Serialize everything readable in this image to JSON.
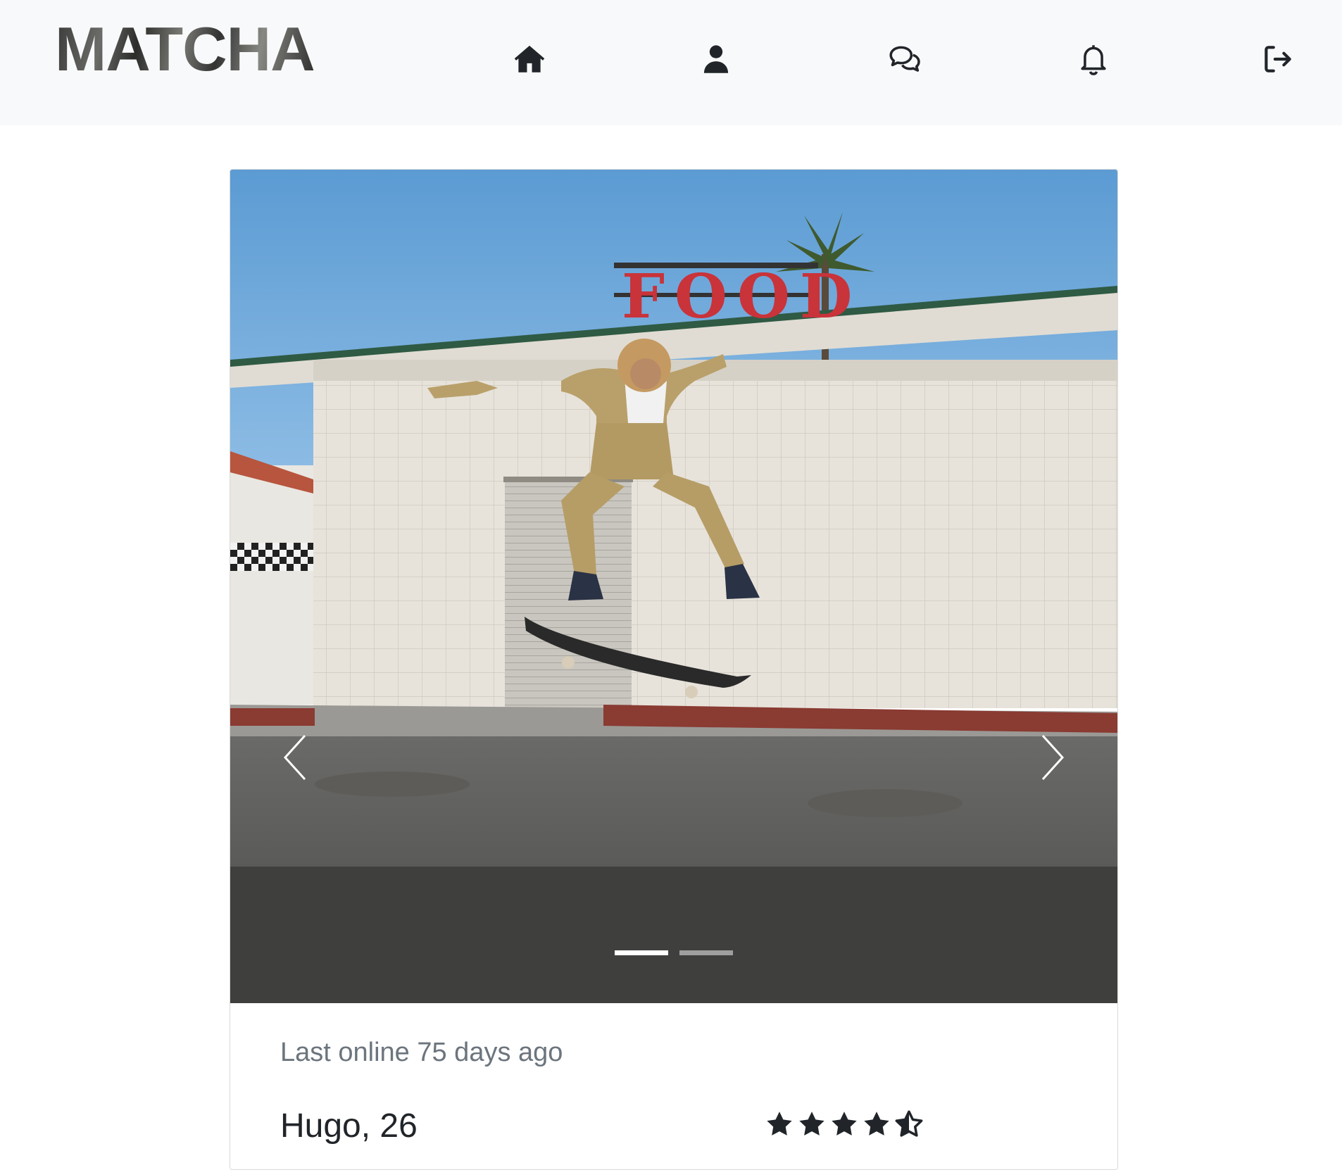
{
  "navbar": {
    "brand": "MATCHA",
    "icons": [
      "home-icon",
      "user-icon",
      "chat-icon",
      "bell-icon",
      "logout-icon"
    ]
  },
  "profile": {
    "carousel": {
      "slide_count": 2,
      "active_index": 0,
      "photo_sign_text": "FOOD"
    },
    "last_online": "Last online 75 days ago",
    "name_age": "Hugo, 26",
    "rating": 4.5,
    "rating_max": 5
  },
  "colors": {
    "navbar_bg": "#f8f9fa",
    "icon": "#212529",
    "muted_text": "#6c757d",
    "text": "#212529"
  }
}
